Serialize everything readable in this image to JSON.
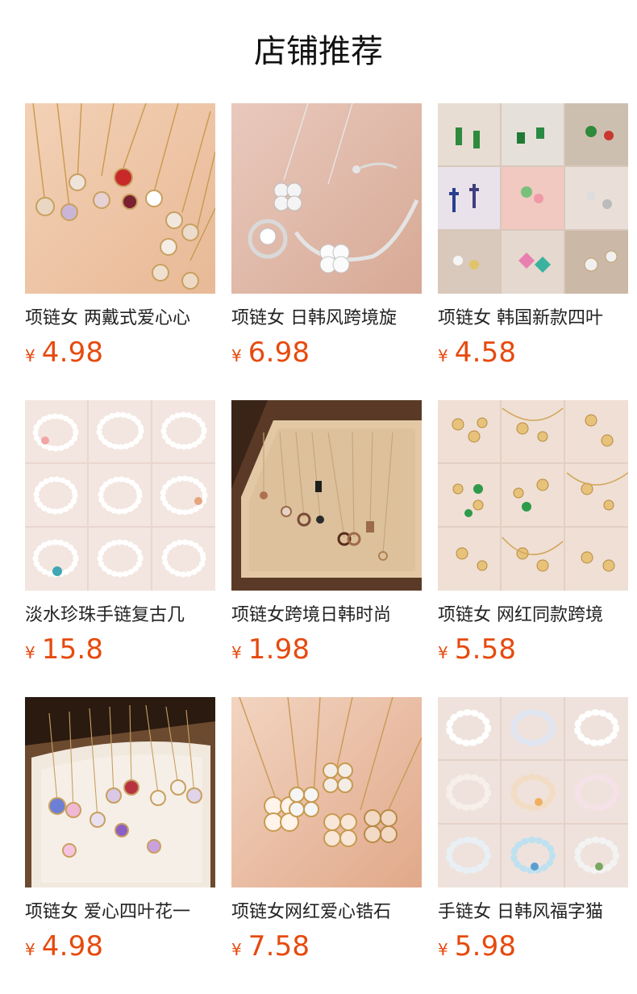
{
  "page": {
    "title": "店铺推荐"
  },
  "colors": {
    "price": "#e64a0e",
    "text": "#222222",
    "background": "#ffffff"
  },
  "products": [
    {
      "title": "项链女 两戴式爱心心",
      "currency": "¥",
      "price": "4.98",
      "image_icon": "gold-four-leaf-necklaces-image"
    },
    {
      "title": "项链女 日韩风跨境旋",
      "currency": "¥",
      "price": "6.98",
      "image_icon": "silver-clover-jewelry-set-image"
    },
    {
      "title": "项链女 韩国新款四叶",
      "currency": "¥",
      "price": "4.58",
      "image_icon": "necklace-collage-image"
    },
    {
      "title": "淡水珍珠手链复古几",
      "currency": "¥",
      "price": "15.8",
      "image_icon": "pearl-bracelet-collage-image"
    },
    {
      "title": "项链女跨境日韩时尚",
      "currency": "¥",
      "price": "1.98",
      "image_icon": "pendant-display-tray-image"
    },
    {
      "title": "项链女 网红同款跨境",
      "currency": "¥",
      "price": "5.58",
      "image_icon": "gold-jewelry-collage-image"
    },
    {
      "title": "项链女 爱心四叶花一",
      "currency": "¥",
      "price": "4.98",
      "image_icon": "heart-clover-necklace-display-image"
    },
    {
      "title": "项链女网红爱心锆石",
      "currency": "¥",
      "price": "7.58",
      "image_icon": "heart-zircon-necklaces-image"
    },
    {
      "title": "手链女 日韩风福字猫",
      "currency": "¥",
      "price": "5.98",
      "image_icon": "crystal-bracelet-collage-image"
    }
  ]
}
